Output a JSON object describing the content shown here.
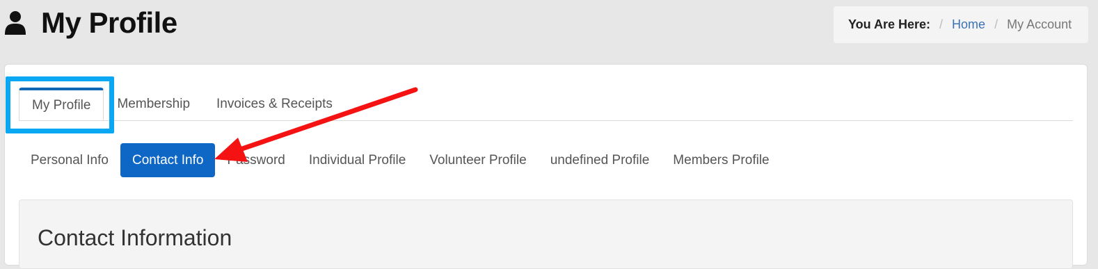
{
  "header": {
    "title": "My Profile",
    "icon": "user-icon"
  },
  "breadcrumb": {
    "label": "You Are Here:",
    "separator": "/",
    "items": [
      "Home",
      "My Account"
    ]
  },
  "tabs": [
    {
      "label": "My Profile",
      "active": true
    },
    {
      "label": "Membership",
      "active": false
    },
    {
      "label": "Invoices & Receipts",
      "active": false
    }
  ],
  "subnav": [
    {
      "label": "Personal Info",
      "active": false
    },
    {
      "label": "Contact Info",
      "active": true
    },
    {
      "label": "Password",
      "active": false
    },
    {
      "label": "Individual Profile",
      "active": false
    },
    {
      "label": "Volunteer Profile",
      "active": false
    },
    {
      "label": "undefined Profile",
      "active": false
    },
    {
      "label": "Members Profile",
      "active": false
    }
  ],
  "section": {
    "heading": "Contact Information"
  },
  "annotations": {
    "highlight_color": "#0aa8f2",
    "arrow_color": "#f41212"
  }
}
